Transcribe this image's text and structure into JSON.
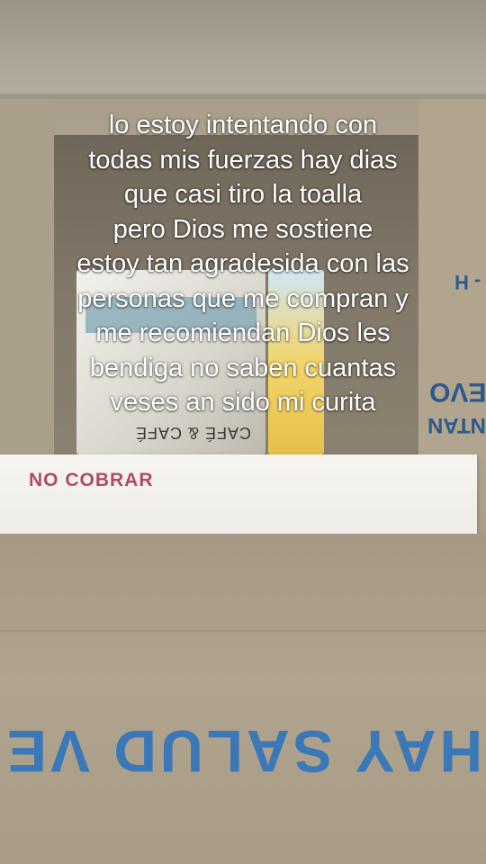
{
  "caption": {
    "lines": [
      "lo estoy intentando con",
      "todas mis fuerzas hay dias",
      "que casi tiro la toalla",
      "pero Dios me sostiene",
      "estoy tan agradesida con las",
      "personas que me compran y",
      "me recomiendan Dios les",
      "bendiga no saben cuantas",
      "veses an sido mi curita"
    ]
  },
  "label_sheet": {
    "stamp": "NO COBRAR"
  },
  "box_print": {
    "bottom": "HAY SALUD VE",
    "right_top": "- H",
    "right_mid": "EVO",
    "right_low": "NTAN",
    "product": "CAFÉ & CAFÉ"
  }
}
